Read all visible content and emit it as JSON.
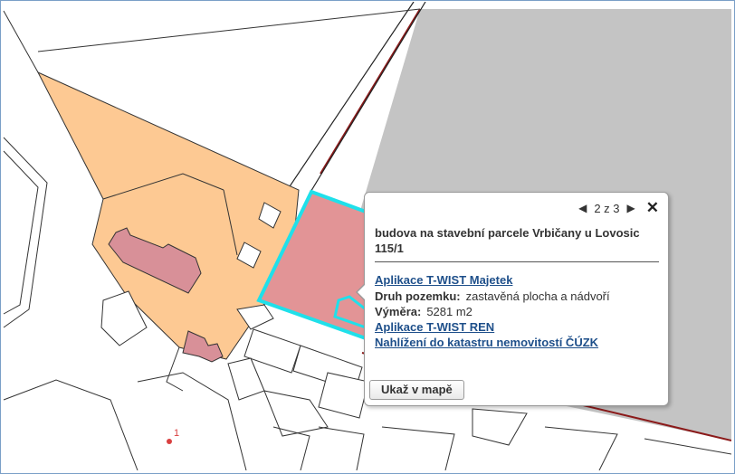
{
  "popup": {
    "pager": "2 z 3",
    "title": "budova na stavební parcele Vrbičany u Lovosic 115/1",
    "link_majetek": "Aplikace T-WIST Majetek",
    "druh_label": "Druh pozemku:",
    "druh_value": "zastavěná plocha a nádvoří",
    "vymera_label": "Výměra:",
    "vymera_value": "5281 m2",
    "link_ren": "Aplikace T-WIST REN",
    "link_cuzk": "Nahlížení do katastru nemovitostí ČÚZK",
    "show_button": "Ukaž v mapě"
  },
  "map": {
    "point_label": "1",
    "colors": {
      "orange_parcel": "#fdc993",
      "building": "#d89098",
      "highlight_parcel": "#e29496",
      "highlight_outline": "#1fe0ea",
      "grey_area": "#c4c4c4",
      "red_boundary": "#8b1a1a",
      "point_marker": "#d94040"
    }
  }
}
